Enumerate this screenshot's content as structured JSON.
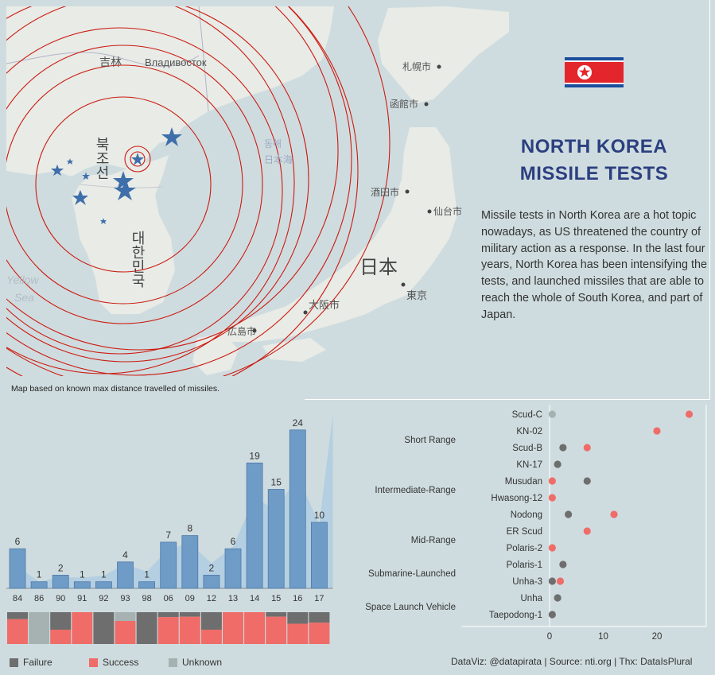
{
  "title_line1": "NORTH KOREA",
  "title_line2": "MISSILE TESTS",
  "description": "Missile tests in North Korea are a hot topic nowadays, as US threatened the country of military action as a response. In the last four years, North Korea has been intensifying the tests, and launched missiles that are able to reach the whole of South Korea, and part of Japan.",
  "map_note": "Map based on known max distance travelled of missiles.",
  "map_labels": {
    "jilin": "吉林",
    "vladivostok": "Владивосток",
    "sapporo": "札幌市",
    "hakodate": "函館市",
    "sakata": "酒田市",
    "sendai": "仙台市",
    "japan": "日本",
    "tokyo": "東京",
    "osaka": "大阪市",
    "hiroshima": "広島市",
    "north_korea": "북조선",
    "south_korea": "대한민국",
    "yellow_sea_1": "Yellow",
    "yellow_sea_2": "Sea",
    "east_sea_1": "동해",
    "east_sea_2": "日本海"
  },
  "legend": {
    "failure": "Failure",
    "success": "Success",
    "unknown": "Unknown"
  },
  "credit": "DataViz: @datapirata | Source: nti.org | Thx: DataIsPlural",
  "colors": {
    "bar": "#6f9cc6",
    "area": "#a8c9e3",
    "failure": "#6e6e6e",
    "success": "#ef6c68",
    "unknown": "#a6b2b2",
    "title": "#2b3f80",
    "circle": "#cc1a10"
  },
  "chart_data": [
    {
      "type": "bar",
      "categories": [
        "84",
        "86",
        "90",
        "91",
        "92",
        "93",
        "98",
        "06",
        "09",
        "12",
        "13",
        "14",
        "15",
        "16",
        "17"
      ],
      "values": [
        6,
        1,
        2,
        1,
        1,
        4,
        1,
        7,
        8,
        2,
        6,
        19,
        15,
        24,
        10
      ],
      "outcome_shares": [
        {
          "failure": 0.2,
          "success": 0.8,
          "unknown": 0
        },
        {
          "failure": 0,
          "success": 0,
          "unknown": 1
        },
        {
          "failure": 0.5,
          "success": 0.5,
          "unknown": 0
        },
        {
          "failure": 0,
          "success": 1,
          "unknown": 0
        },
        {
          "failure": 1,
          "success": 0,
          "unknown": 0
        },
        {
          "failure": 0,
          "success": 0.75,
          "unknown": 0.25
        },
        {
          "failure": 1,
          "success": 0,
          "unknown": 0
        },
        {
          "failure": 0.14,
          "success": 0.86,
          "unknown": 0
        },
        {
          "failure": 0.13,
          "success": 0.87,
          "unknown": 0
        },
        {
          "failure": 0.5,
          "success": 0.5,
          "unknown": 0
        },
        {
          "failure": 0,
          "success": 1,
          "unknown": 0
        },
        {
          "failure": 0,
          "success": 1,
          "unknown": 0
        },
        {
          "failure": 0.13,
          "success": 0.87,
          "unknown": 0
        },
        {
          "failure": 0.33,
          "success": 0.67,
          "unknown": 0
        },
        {
          "failure": 0.3,
          "success": 0.7,
          "unknown": 0
        }
      ]
    },
    {
      "type": "scatter",
      "missiles": [
        "Scud-C",
        "KN-02",
        "Scud-B",
        "KN-17",
        "Musudan",
        "Hwasong-12",
        "Nodong",
        "ER Scud",
        "Polaris-2",
        "Polaris-1",
        "Unha-3",
        "Unha",
        "Taepodong-1"
      ],
      "groups": [
        {
          "label": "Short Range",
          "at": "KN-02"
        },
        {
          "label": "Intermediate-Range",
          "at": "Musudan"
        },
        {
          "label": "Mid-Range",
          "at": "ER Scud"
        },
        {
          "label": "Submarine-Launched",
          "at": "Polaris-1"
        },
        {
          "label": "Space Launch Vehicle",
          "at": "Unha"
        }
      ],
      "series": [
        {
          "name": "Failure",
          "values": [
            null,
            null,
            2.5,
            1.5,
            7,
            null,
            3.5,
            null,
            null,
            2.5,
            0.5,
            1.5,
            0.5
          ]
        },
        {
          "name": "Success",
          "values": [
            26,
            20,
            7,
            null,
            0.5,
            0.5,
            12,
            7,
            0.5,
            null,
            2,
            null,
            null
          ]
        },
        {
          "name": "Unknown",
          "values": [
            0.5,
            null,
            null,
            null,
            null,
            null,
            null,
            null,
            null,
            null,
            null,
            null,
            null
          ]
        }
      ],
      "x_ticks": [
        "0",
        "10",
        "20"
      ],
      "xlim": [
        0,
        28
      ]
    }
  ]
}
